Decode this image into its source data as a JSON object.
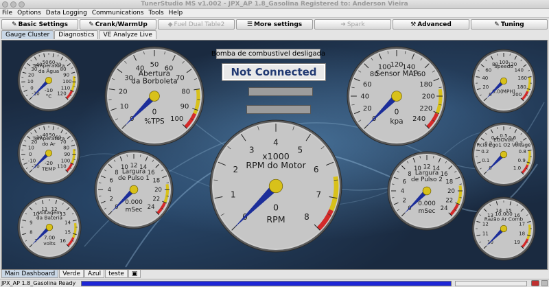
{
  "window": {
    "title": "TunerStudio MS v1.002 - JPX_AP 1.8_Gasolina Registered to: Anderson Vieira"
  },
  "menu": [
    "File",
    "Options",
    "Data Logging",
    "Communications",
    "Tools",
    "Help"
  ],
  "toolbar": [
    {
      "label": "Basic Settings",
      "icon": "wrench-icon",
      "enabled": true
    },
    {
      "label": "Crank/WarmUp",
      "icon": "wrench-icon",
      "enabled": true
    },
    {
      "label": "Fuel Dual Table2",
      "icon": "fuel-icon",
      "enabled": false
    },
    {
      "label": "More settings",
      "icon": "sliders-icon",
      "enabled": true
    },
    {
      "label": "Spark",
      "icon": "arrow-right-icon",
      "enabled": false
    },
    {
      "label": "Advanced",
      "icon": "hammer-icon",
      "enabled": true
    },
    {
      "label": "Tuning",
      "icon": "wrench-icon",
      "enabled": true
    }
  ],
  "tabs": [
    "Gauge Cluster",
    "Diagnostics",
    "VE Analyze Live"
  ],
  "active_tab": "Gauge Cluster",
  "indicators": {
    "fuel_pump": "Bomba de combustivel desligada",
    "connection": "Not Connected"
  },
  "gauges": {
    "water_temp": {
      "title": [
        "Temperatura",
        "da Água"
      ],
      "unit": "°C",
      "value_text": "-10",
      "ticks": [
        "-10",
        "0",
        "10",
        "20",
        "30",
        "40",
        "50",
        "60",
        "70",
        "80",
        "90",
        "100",
        "110",
        "120"
      ],
      "value": -10,
      "min": -10,
      "max": 120
    },
    "air_temp": {
      "title": [
        "Temperatura",
        "do Ar"
      ],
      "unit": "TEMP",
      "value_text": "-20",
      "ticks": [
        "-20",
        "-10",
        "0",
        "10",
        "20",
        "30",
        "40",
        "50",
        "60",
        "70",
        "80",
        "90",
        "100",
        "110"
      ],
      "value": -20,
      "min": -20,
      "max": 110
    },
    "battery": {
      "title": [
        "Voltagem",
        "da Bateria"
      ],
      "unit": "volts",
      "value_text": "7.00",
      "ticks": [
        "7",
        "8",
        "9",
        "10",
        "11",
        "12",
        "13",
        "14",
        "15",
        "16"
      ],
      "value": 7,
      "min": 7,
      "max": 16
    },
    "throttle": {
      "title": [
        "Abertura",
        "da Borboleta"
      ],
      "unit": "%TPS",
      "value_text": "0",
      "ticks": [
        "0",
        "10",
        "20",
        "30",
        "40",
        "50",
        "60",
        "70",
        "80",
        "90",
        "100"
      ],
      "value": 0,
      "min": 0,
      "max": 100
    },
    "pw1": {
      "title": [
        "Largura",
        "de Pulso 1"
      ],
      "unit": "mSec",
      "value_text": "0.000",
      "ticks": [
        "0",
        "2",
        "4",
        "6",
        "8",
        "10",
        "12",
        "14",
        "16",
        "18",
        "20",
        "22",
        "24"
      ],
      "value": 0,
      "min": 0,
      "max": 24
    },
    "rpm": {
      "title": [
        "x1000",
        "RPM do Motor"
      ],
      "unit": "RPM",
      "value_text": "0",
      "ticks": [
        "0",
        "1",
        "2",
        "3",
        "4",
        "5",
        "6",
        "7",
        "8"
      ],
      "value": 0,
      "min": 0,
      "max": 8
    },
    "map": {
      "title": [
        "Sensor MAP"
      ],
      "unit": "kpa",
      "value_text": "0",
      "ticks": [
        "0",
        "20",
        "40",
        "60",
        "80",
        "100",
        "120",
        "140",
        "160",
        "180",
        "200",
        "220",
        "240"
      ],
      "value": 0,
      "min": 0,
      "max": 240
    },
    "pw2": {
      "title": [
        "Largura",
        "de Pulso 2"
      ],
      "unit": "mSec",
      "value_text": "0.000",
      "ticks": [
        "0",
        "2",
        "4",
        "6",
        "8",
        "10",
        "12",
        "14",
        "16",
        "18",
        "20",
        "22",
        "24"
      ],
      "value": 0,
      "min": 0,
      "max": 24
    },
    "speed": {
      "title": [
        "Speedo"
      ],
      "unit": "",
      "value_text": "0.0(MPH)",
      "ticks": [
        "0",
        "20",
        "40",
        "60",
        "80",
        "100",
        "120",
        "140",
        "160",
        "180",
        "200"
      ],
      "value": 0,
      "min": 0,
      "max": 200
    },
    "egovolt": {
      "title": [
        "EGOVolt",
        "Rcia Ego1 O2 Voltage"
      ],
      "unit": "",
      "value_text": "",
      "ticks": [
        "0",
        "0.1",
        "0.2",
        "0.3",
        "0.4",
        "0.5",
        "0.6",
        "0.7",
        "0.8",
        "0.9",
        "1.0"
      ],
      "value": 0,
      "min": 0,
      "max": 1
    },
    "afr": {
      "title": [
        "10.000",
        "Razão Ar Comb"
      ],
      "unit": "",
      "value_text": "",
      "ticks": [
        "10",
        "11",
        "12",
        "13",
        "14",
        "15",
        "16",
        "17",
        "18",
        "19"
      ],
      "value": 10,
      "min": 10,
      "max": 19
    }
  },
  "bottom_tabs": [
    "Main Dashboard",
    "Verde",
    "Azul",
    "teste"
  ],
  "active_bottom_tab": "Main Dashboard",
  "status": {
    "text": "JPX_AP 1.8_Gasolina Ready",
    "progress": 1.0
  },
  "colors": {
    "needle": "#1c2e9a",
    "yellow_zone": "#d8c11a",
    "red_zone": "#d42a2a",
    "progress": "#1e26d6"
  }
}
